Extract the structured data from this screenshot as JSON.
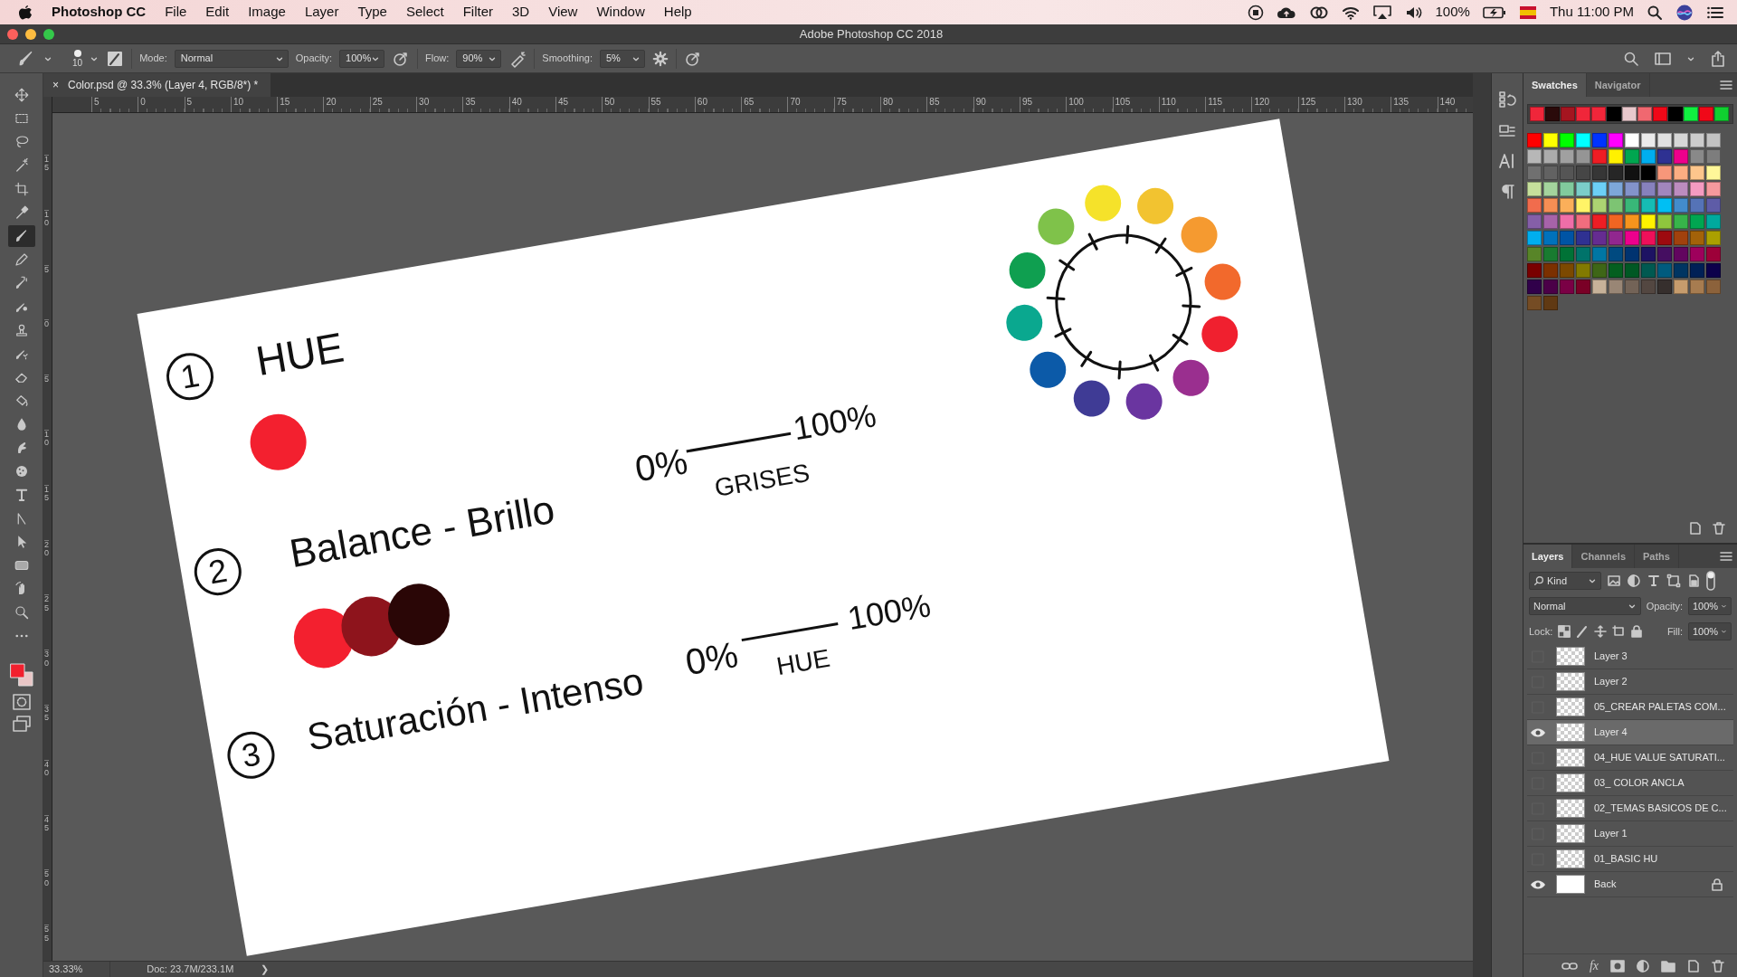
{
  "menu_bar": {
    "app": "Photoshop CC",
    "menus": [
      "File",
      "Edit",
      "Image",
      "Layer",
      "Type",
      "Select",
      "Filter",
      "3D",
      "View",
      "Window",
      "Help"
    ],
    "battery": "100%",
    "clock": "Thu 11:00 PM"
  },
  "window": {
    "title": "Adobe Photoshop CC 2018"
  },
  "options_bar": {
    "brush_size": "10",
    "mode_label": "Mode:",
    "mode": "Normal",
    "opacity_label": "Opacity:",
    "opacity": "100%",
    "flow_label": "Flow:",
    "flow": "90%",
    "smoothing_label": "Smoothing:",
    "smoothing": "5%"
  },
  "document_tab": {
    "close": "×",
    "title": "Color.psd @ 33.3% (Layer 4, RGB/8*) *"
  },
  "rulers": {
    "horizontal": [
      "5",
      "0",
      "5",
      "10",
      "15",
      "20",
      "25",
      "30",
      "35",
      "40",
      "45",
      "50",
      "55",
      "60",
      "65",
      "70",
      "75",
      "80",
      "85",
      "90",
      "95",
      "100",
      "105",
      "110",
      "115",
      "120",
      "125",
      "130",
      "135",
      "140"
    ],
    "vertical": [
      "15",
      "10",
      "5",
      "0",
      "5",
      "10",
      "15",
      "20",
      "25",
      "30",
      "35",
      "40",
      "45",
      "50",
      "55"
    ]
  },
  "tools": [
    {
      "kind": "move",
      "selected": false
    },
    {
      "kind": "marquee",
      "selected": false
    },
    {
      "kind": "lasso",
      "selected": false
    },
    {
      "kind": "wand",
      "selected": false
    },
    {
      "kind": "crop",
      "selected": false
    },
    {
      "kind": "eyedropper",
      "selected": false
    },
    {
      "kind": "brush",
      "selected": true
    },
    {
      "kind": "pencil",
      "selected": false
    },
    {
      "kind": "healing",
      "selected": false
    },
    {
      "kind": "mixer",
      "selected": false
    },
    {
      "kind": "stamp",
      "selected": false
    },
    {
      "kind": "history",
      "selected": false
    },
    {
      "kind": "eraser",
      "selected": false
    },
    {
      "kind": "bucket",
      "selected": false
    },
    {
      "kind": "drop",
      "selected": false
    },
    {
      "kind": "finger",
      "selected": false
    },
    {
      "kind": "sponge",
      "selected": false
    },
    {
      "kind": "type",
      "selected": false
    },
    {
      "kind": "path",
      "selected": false
    },
    {
      "kind": "arrow",
      "selected": false
    },
    {
      "kind": "shape",
      "selected": false
    },
    {
      "kind": "hand",
      "selected": false
    },
    {
      "kind": "zoom",
      "selected": false
    },
    {
      "kind": "more",
      "selected": false
    }
  ],
  "canvas": {
    "rows": [
      {
        "number": "1",
        "label": "HUE"
      },
      {
        "number": "2",
        "label": "Balance - Brillo",
        "scale_start": "0%",
        "scale_end": "100%",
        "scale_caption": "GRISES"
      },
      {
        "number": "3",
        "label": "Saturación - Intenso",
        "scale_start": "0%",
        "scale_end": "100%",
        "scale_caption": "HUE"
      }
    ],
    "sample_dots": [
      {
        "color": "#f3202f"
      },
      {
        "color": "#f3202f"
      },
      {
        "color": "#8e141c"
      },
      {
        "color": "#2a0606"
      }
    ],
    "color_wheel": [
      {
        "color": "#f5e22a"
      },
      {
        "color": "#f2c330"
      },
      {
        "color": "#f59a30"
      },
      {
        "color": "#f2692c"
      },
      {
        "color": "#f0202f"
      },
      {
        "color": "#9a2f8f"
      },
      {
        "color": "#6a35a0"
      },
      {
        "color": "#3f3b95"
      },
      {
        "color": "#0c5aa8"
      },
      {
        "color": "#0aa88f"
      },
      {
        "color": "#0f9f50"
      },
      {
        "color": "#7fc24a"
      }
    ]
  },
  "status_bar": {
    "zoom": "33.33%",
    "doc": "Doc: 23.7M/233.1M",
    "arrow": "❯"
  },
  "swatches_panel": {
    "tabs": [
      {
        "label": "Swatches",
        "selected": true
      },
      {
        "label": "Navigator",
        "selected": false
      }
    ],
    "recent": [
      {
        "color": "#f0263a"
      },
      {
        "color": "#2a0a0a"
      },
      {
        "color": "#a51520"
      },
      {
        "color": "#f0263a"
      },
      {
        "color": "#f0263a"
      },
      {
        "color": "#000000"
      },
      {
        "color": "#e8c8cc"
      },
      {
        "color": "#f06870"
      },
      {
        "color": "#f00818"
      },
      {
        "color": "#000000"
      },
      {
        "color": "#10f040"
      },
      {
        "color": "#f00818"
      },
      {
        "color": "#10d030"
      }
    ],
    "swatches": [
      {
        "color": "#ff0000"
      },
      {
        "color": "#ffff00"
      },
      {
        "color": "#00ff00"
      },
      {
        "color": "#00ffff"
      },
      {
        "color": "#0033ff"
      },
      {
        "color": "#ff00ff"
      },
      {
        "color": "#ffffff"
      },
      {
        "color": "#ebebeb"
      },
      {
        "color": "#e1e1e1"
      },
      {
        "color": "#d7d7d7"
      },
      {
        "color": "#cccccc"
      },
      {
        "color": "#c2c2c2"
      },
      {
        "color": "#b7b7b7"
      },
      {
        "color": "#acacac"
      },
      {
        "color": "#a0a0a0"
      },
      {
        "color": "#959595"
      },
      {
        "color": "#ee1d24"
      },
      {
        "color": "#fff100"
      },
      {
        "color": "#00a650"
      },
      {
        "color": "#00aeef"
      },
      {
        "color": "#2e3192"
      },
      {
        "color": "#ed008c"
      },
      {
        "color": "#898989"
      },
      {
        "color": "#7d7d7d"
      },
      {
        "color": "#707070"
      },
      {
        "color": "#626262"
      },
      {
        "color": "#555555"
      },
      {
        "color": "#464646"
      },
      {
        "color": "#363636"
      },
      {
        "color": "#262626"
      },
      {
        "color": "#111111"
      },
      {
        "color": "#000000"
      },
      {
        "color": "#f7977a"
      },
      {
        "color": "#fbad82"
      },
      {
        "color": "#fdc68c"
      },
      {
        "color": "#fff799"
      },
      {
        "color": "#c6df9c"
      },
      {
        "color": "#a4d49d"
      },
      {
        "color": "#81ca9d"
      },
      {
        "color": "#7bcdc9"
      },
      {
        "color": "#6ccff6"
      },
      {
        "color": "#7da7d9"
      },
      {
        "color": "#8393ca"
      },
      {
        "color": "#8781bd"
      },
      {
        "color": "#a286bd"
      },
      {
        "color": "#bc8cbf"
      },
      {
        "color": "#f49bc1"
      },
      {
        "color": "#f5999d"
      },
      {
        "color": "#f16c4d"
      },
      {
        "color": "#f68e54"
      },
      {
        "color": "#fbaf5a"
      },
      {
        "color": "#fff467"
      },
      {
        "color": "#acd372"
      },
      {
        "color": "#7dc473"
      },
      {
        "color": "#39b778"
      },
      {
        "color": "#16bcb4"
      },
      {
        "color": "#00bff3"
      },
      {
        "color": "#438ccb"
      },
      {
        "color": "#5573b7"
      },
      {
        "color": "#5e5ca7"
      },
      {
        "color": "#855fa8"
      },
      {
        "color": "#a763a9"
      },
      {
        "color": "#ef6ea8"
      },
      {
        "color": "#f16d7e"
      },
      {
        "color": "#ee1d24"
      },
      {
        "color": "#f16522"
      },
      {
        "color": "#f7941d"
      },
      {
        "color": "#fff200"
      },
      {
        "color": "#8fc63d"
      },
      {
        "color": "#37b44a"
      },
      {
        "color": "#00a651"
      },
      {
        "color": "#00a99e"
      },
      {
        "color": "#00aeee"
      },
      {
        "color": "#0072bc"
      },
      {
        "color": "#0054a5"
      },
      {
        "color": "#2f3192"
      },
      {
        "color": "#652c91"
      },
      {
        "color": "#91278f"
      },
      {
        "color": "#ed008d"
      },
      {
        "color": "#ee105a"
      },
      {
        "color": "#9d0a0f"
      },
      {
        "color": "#a1410d"
      },
      {
        "color": "#a36209"
      },
      {
        "color": "#aba000"
      },
      {
        "color": "#588528"
      },
      {
        "color": "#197b30"
      },
      {
        "color": "#007236"
      },
      {
        "color": "#00736a"
      },
      {
        "color": "#0076a4"
      },
      {
        "color": "#004a80"
      },
      {
        "color": "#003370"
      },
      {
        "color": "#1d1363"
      },
      {
        "color": "#450e61"
      },
      {
        "color": "#62055f"
      },
      {
        "color": "#9e005c"
      },
      {
        "color": "#9d0039"
      },
      {
        "color": "#790000"
      },
      {
        "color": "#7b3000"
      },
      {
        "color": "#7c4900"
      },
      {
        "color": "#827a00"
      },
      {
        "color": "#3e6617"
      },
      {
        "color": "#045f20"
      },
      {
        "color": "#005824"
      },
      {
        "color": "#005951"
      },
      {
        "color": "#005b7e"
      },
      {
        "color": "#003562"
      },
      {
        "color": "#002056"
      },
      {
        "color": "#0c004b"
      },
      {
        "color": "#30004a"
      },
      {
        "color": "#4b0048"
      },
      {
        "color": "#7a0045"
      },
      {
        "color": "#7a0026"
      },
      {
        "color": "#c7b299"
      },
      {
        "color": "#998675"
      },
      {
        "color": "#736357"
      },
      {
        "color": "#534741"
      },
      {
        "color": "#362f2d"
      },
      {
        "color": "#c69c6d"
      },
      {
        "color": "#a77c50"
      },
      {
        "color": "#8c623b"
      },
      {
        "color": "#754c24"
      },
      {
        "color": "#603913"
      }
    ]
  },
  "layers_panel": {
    "tabs": [
      {
        "label": "Layers",
        "selected": true
      },
      {
        "label": "Channels",
        "selected": false
      },
      {
        "label": "Paths",
        "selected": false
      }
    ],
    "filter": "Kind",
    "blend_mode": "Normal",
    "opacity_label": "Opacity:",
    "opacity": "100%",
    "lock_label": "Lock:",
    "fill_label": "Fill:",
    "fill": "100%",
    "layers": [
      {
        "name": "Layer 3",
        "kind": "pixel",
        "visible": false,
        "selected": false
      },
      {
        "name": "Layer 2",
        "kind": "pixel",
        "visible": false,
        "selected": false
      },
      {
        "name": "05_CREAR PALETAS COM...",
        "kind": "pixel",
        "visible": false,
        "selected": false
      },
      {
        "name": "Layer 4",
        "kind": "pixel",
        "visible": true,
        "selected": true
      },
      {
        "name": "04_HUE VALUE SATURATI...",
        "kind": "pixel",
        "visible": false,
        "selected": false
      },
      {
        "name": "03_ COLOR ANCLA",
        "kind": "pixel",
        "visible": false,
        "selected": false
      },
      {
        "name": "02_TEMAS BASICOS DE C...",
        "kind": "pixel",
        "visible": false,
        "selected": false
      },
      {
        "name": "Layer 1",
        "kind": "pixel",
        "visible": false,
        "selected": false
      },
      {
        "name": "01_BASIC HU",
        "kind": "pixel",
        "visible": false,
        "selected": false
      },
      {
        "name": "Back",
        "kind": "background",
        "visible": true,
        "selected": false
      }
    ],
    "fx_label": "fx"
  }
}
